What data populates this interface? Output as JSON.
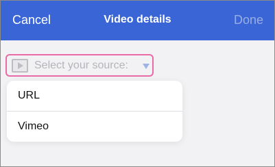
{
  "header": {
    "cancel_label": "Cancel",
    "title": "Video details",
    "done_label": "Done"
  },
  "source": {
    "placeholder": "Select your source:",
    "icon": "play-icon",
    "options": [
      {
        "label": "URL"
      },
      {
        "label": "Vimeo"
      }
    ]
  },
  "colors": {
    "nav_background": "#3a65d6",
    "highlight_border": "#e86aa6",
    "done_disabled": "#9aaee4"
  }
}
